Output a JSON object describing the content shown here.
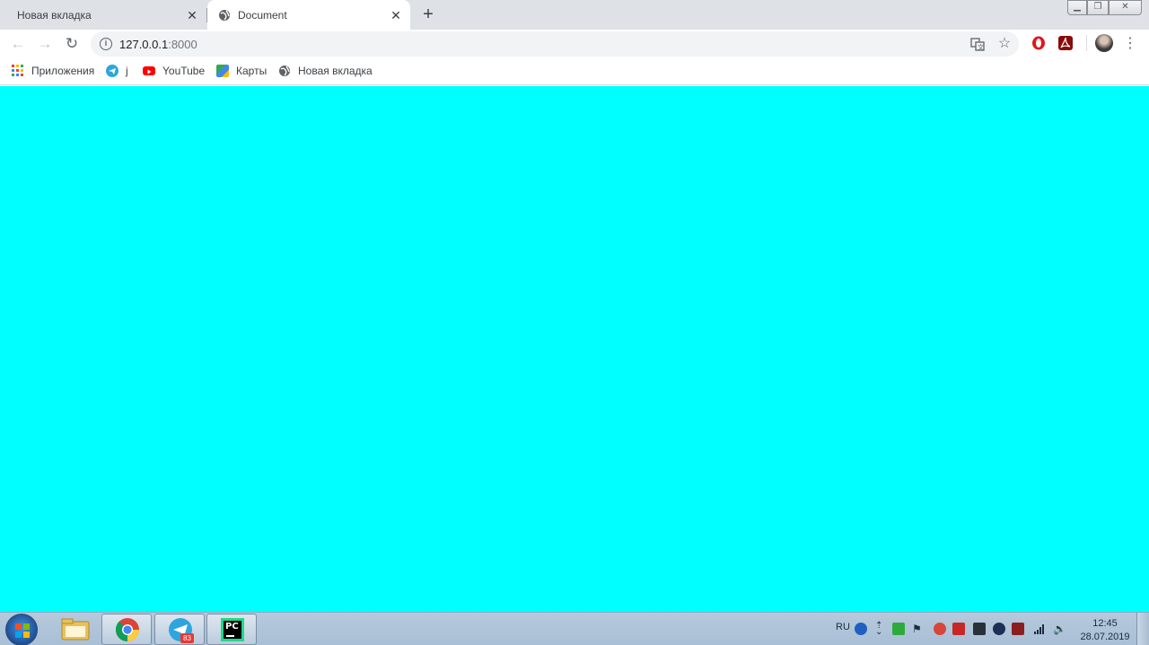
{
  "tabs": [
    {
      "title": "Новая вкладка",
      "active": false
    },
    {
      "title": "Document",
      "active": true
    }
  ],
  "toolbar": {
    "url_host": "127.0.0.1",
    "url_port": ":8000"
  },
  "bookmarks": [
    {
      "label": "Приложения",
      "icon": "apps-grid-icon"
    },
    {
      "label": "j",
      "icon": "telegram-icon"
    },
    {
      "label": "YouTube",
      "icon": "youtube-icon"
    },
    {
      "label": "Карты",
      "icon": "maps-icon"
    },
    {
      "label": "Новая вкладка",
      "icon": "globe-icon"
    }
  ],
  "page": {
    "background": "#00ffff"
  },
  "taskbar": {
    "language": "RU",
    "time": "12:45",
    "date": "28.07.2019",
    "telegram_badge": "83",
    "pycharm_label": "PC"
  },
  "colors": {
    "tab_strip": "#dee1e6",
    "page_bg": "#00ffff",
    "opera_red": "#e0161f",
    "taskbar": "#b6c9dc"
  }
}
